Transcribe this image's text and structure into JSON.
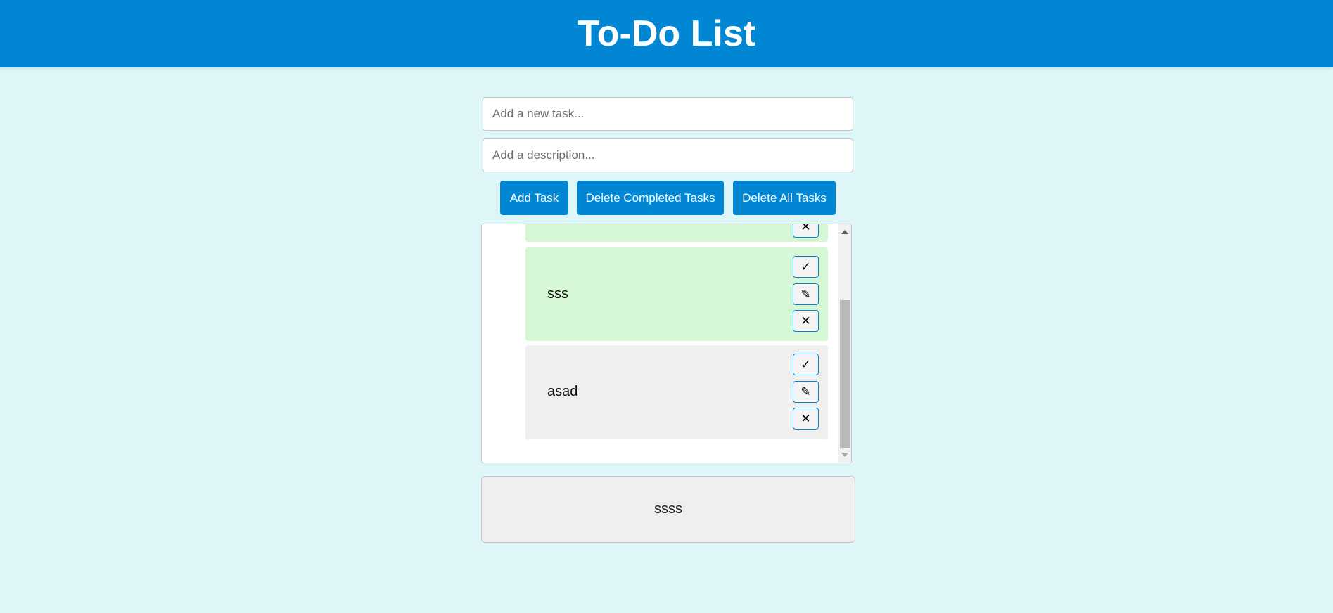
{
  "header": {
    "title": "To-Do List"
  },
  "form": {
    "task_placeholder": "Add a new task...",
    "task_value": "",
    "description_placeholder": "Add a description...",
    "description_value": ""
  },
  "actions": {
    "add_label": "Add Task",
    "delete_completed_label": "Delete Completed Tasks",
    "delete_all_label": "Delete All Tasks"
  },
  "task_buttons": {
    "complete_icon": "✓",
    "edit_icon": "✎",
    "delete_icon": "✕"
  },
  "tasks": [
    {
      "title": "",
      "status": "completed"
    },
    {
      "title": "sss",
      "status": "completed"
    },
    {
      "title": "asad",
      "status": "pending"
    }
  ],
  "detail": {
    "text": "ssss"
  },
  "colors": {
    "accent": "#0086d3",
    "background": "#dff6f9",
    "completed_task": "#d5f7d5",
    "pending_task": "#efefef"
  }
}
